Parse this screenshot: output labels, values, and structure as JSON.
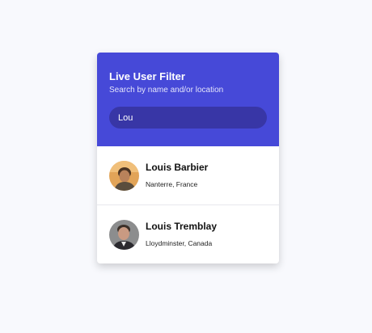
{
  "header": {
    "title": "Live User Filter",
    "subtitle": "Search by name and/or location"
  },
  "search": {
    "value": "Lou"
  },
  "users": [
    {
      "name": "Louis Barbier",
      "location": "Nanterre, France",
      "avatar_icon": "person-photo-icon"
    },
    {
      "name": "Louis Tremblay",
      "location": "Lloydminster, Canada",
      "avatar_icon": "person-photo-icon"
    }
  ],
  "colors": {
    "accent": "#4649d8",
    "search_bg": "#3836a6",
    "page_bg": "#f8f9fd"
  }
}
